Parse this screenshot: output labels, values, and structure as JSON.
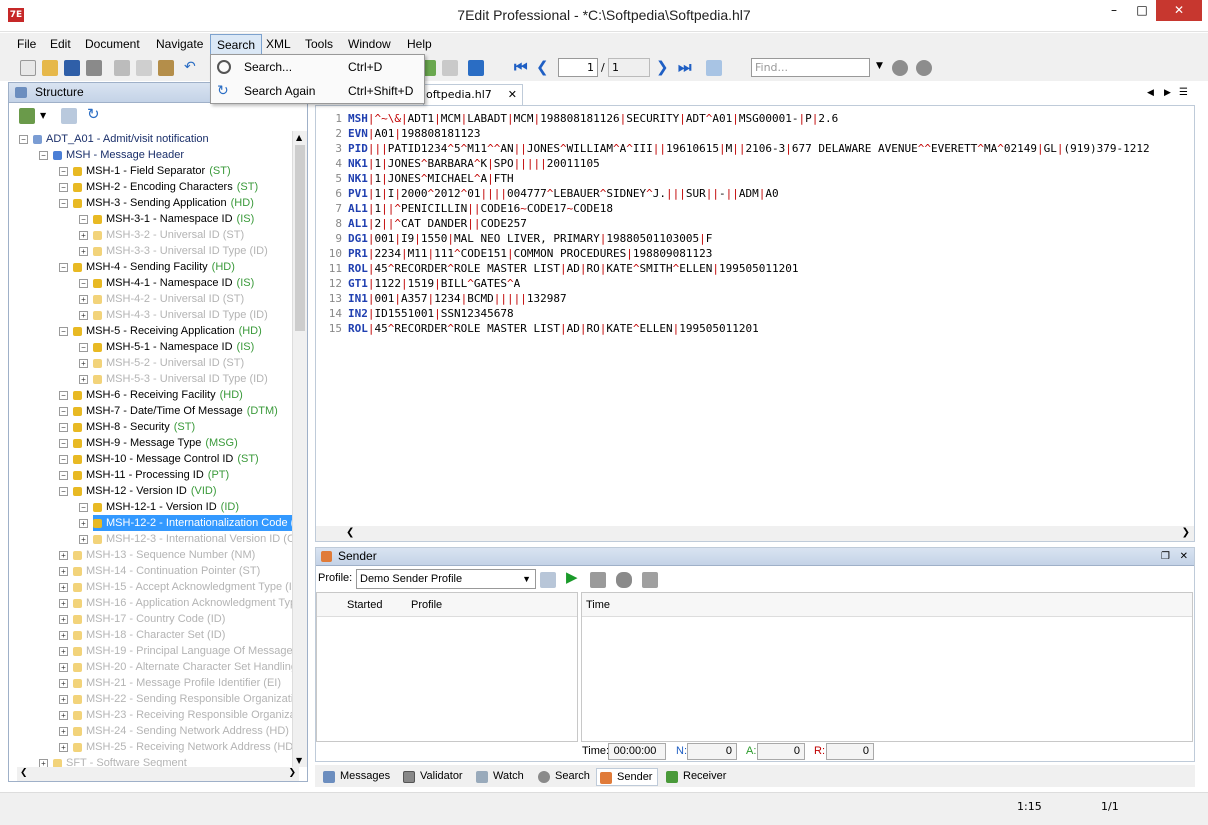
{
  "window": {
    "title": "7Edit Professional - *C:\\Softpedia\\Softpedia.hl7"
  },
  "menu": [
    "File",
    "Edit",
    "Document",
    "Navigate",
    "Search",
    "XML",
    "Tools",
    "Window",
    "Help"
  ],
  "search_menu": [
    {
      "label": "Search...",
      "shortcut": "Ctrl+D"
    },
    {
      "label": "Search Again",
      "shortcut": "Ctrl+Shift+D"
    }
  ],
  "toolbar": {
    "page_current": "1",
    "page_sep": "/",
    "page_total": "1",
    "find_placeholder": "Find..."
  },
  "structure": {
    "title": "Structure",
    "rows": [
      {
        "text": "ADT_A01 - Admit/visit notification",
        "type": "",
        "level": 0,
        "style": "root"
      },
      {
        "text": "MSH - Message Header",
        "type": "",
        "level": 1,
        "style": "seg"
      },
      {
        "text": "MSH-1 - Field Separator",
        "type": "(ST)",
        "level": 2,
        "style": "f"
      },
      {
        "text": "MSH-2 - Encoding Characters",
        "type": "(ST)",
        "level": 2,
        "style": "f"
      },
      {
        "text": "MSH-3 - Sending Application",
        "type": "(HD)",
        "level": 2,
        "style": "f"
      },
      {
        "text": "MSH-3-1 - Namespace ID",
        "type": "(IS)",
        "level": 3,
        "style": "f"
      },
      {
        "text": "MSH-3-2 - Universal ID (ST)",
        "type": "",
        "level": 3,
        "style": "lite"
      },
      {
        "text": "MSH-3-3 - Universal ID Type (ID)",
        "type": "",
        "level": 3,
        "style": "lite"
      },
      {
        "text": "MSH-4 - Sending Facility",
        "type": "(HD)",
        "level": 2,
        "style": "f"
      },
      {
        "text": "MSH-4-1 - Namespace ID",
        "type": "(IS)",
        "level": 3,
        "style": "f"
      },
      {
        "text": "MSH-4-2 - Universal ID (ST)",
        "type": "",
        "level": 3,
        "style": "lite"
      },
      {
        "text": "MSH-4-3 - Universal ID Type (ID)",
        "type": "",
        "level": 3,
        "style": "lite"
      },
      {
        "text": "MSH-5 - Receiving Application",
        "type": "(HD)",
        "level": 2,
        "style": "f"
      },
      {
        "text": "MSH-5-1 - Namespace ID",
        "type": "(IS)",
        "level": 3,
        "style": "f"
      },
      {
        "text": "MSH-5-2 - Universal ID (ST)",
        "type": "",
        "level": 3,
        "style": "lite"
      },
      {
        "text": "MSH-5-3 - Universal ID Type (ID)",
        "type": "",
        "level": 3,
        "style": "lite"
      },
      {
        "text": "MSH-6 - Receiving Facility",
        "type": "(HD)",
        "level": 2,
        "style": "f"
      },
      {
        "text": "MSH-7 - Date/Time Of Message",
        "type": "(DTM)",
        "level": 2,
        "style": "f"
      },
      {
        "text": "MSH-8 - Security",
        "type": "(ST)",
        "level": 2,
        "style": "f"
      },
      {
        "text": "MSH-9 - Message Type",
        "type": "(MSG)",
        "level": 2,
        "style": "f"
      },
      {
        "text": "MSH-10 - Message Control ID",
        "type": "(ST)",
        "level": 2,
        "style": "f"
      },
      {
        "text": "MSH-11 - Processing ID",
        "type": "(PT)",
        "level": 2,
        "style": "f"
      },
      {
        "text": "MSH-12 - Version ID",
        "type": "(VID)",
        "level": 2,
        "style": "f"
      },
      {
        "text": "MSH-12-1 - Version ID",
        "type": "(ID)",
        "level": 3,
        "style": "f"
      },
      {
        "text": "MSH-12-2 - Internationalization Code (CW",
        "type": "",
        "level": 3,
        "style": "sel"
      },
      {
        "text": "MSH-12-3 - International Version ID (CWE",
        "type": "",
        "level": 3,
        "style": "lite"
      },
      {
        "text": "MSH-13 - Sequence Number (NM)",
        "type": "",
        "level": 2,
        "style": "lite"
      },
      {
        "text": "MSH-14 - Continuation Pointer (ST)",
        "type": "",
        "level": 2,
        "style": "lite"
      },
      {
        "text": "MSH-15 - Accept Acknowledgment Type (ID)",
        "type": "",
        "level": 2,
        "style": "lite"
      },
      {
        "text": "MSH-16 - Application Acknowledgment Type (",
        "type": "",
        "level": 2,
        "style": "lite"
      },
      {
        "text": "MSH-17 - Country Code (ID)",
        "type": "",
        "level": 2,
        "style": "lite"
      },
      {
        "text": "MSH-18 - Character Set (ID)",
        "type": "",
        "level": 2,
        "style": "lite"
      },
      {
        "text": "MSH-19 - Principal Language Of Message (CW",
        "type": "",
        "level": 2,
        "style": "lite"
      },
      {
        "text": "MSH-20 - Alternate Character Set Handling S",
        "type": "",
        "level": 2,
        "style": "lite"
      },
      {
        "text": "MSH-21 - Message Profile Identifier (EI)",
        "type": "",
        "level": 2,
        "style": "lite"
      },
      {
        "text": "MSH-22 - Sending Responsible Organization (",
        "type": "",
        "level": 2,
        "style": "lite"
      },
      {
        "text": "MSH-23 - Receiving Responsible Organization",
        "type": "",
        "level": 2,
        "style": "lite"
      },
      {
        "text": "MSH-24 - Sending Network Address (HD)",
        "type": "",
        "level": 2,
        "style": "lite"
      },
      {
        "text": "MSH-25 - Receiving Network Address (HD)",
        "type": "",
        "level": 2,
        "style": "lite"
      },
      {
        "text": "SFT - Software Segment",
        "type": "",
        "level": 1,
        "style": "lite"
      }
    ]
  },
  "editor": {
    "tab": "oftpedia.hl7",
    "lines": [
      {
        "n": "1",
        "seg": "MSH",
        "rest": "|^~\\&|ADT1|MCM|LABADT|MCM|198808181126|SECURITY|ADT^A01|MSG00001-|P|2.6"
      },
      {
        "n": "2",
        "seg": "EVN",
        "rest": "|A01|198808181123"
      },
      {
        "n": "3",
        "seg": "PID",
        "rest": "|||PATID1234^5^M11^^AN||JONES^WILLIAM^A^III||19610615|M||2106-3|677 DELAWARE AVENUE^^EVERETT^MA^02149|GL|(919)379-1212"
      },
      {
        "n": "4",
        "seg": "NK1",
        "rest": "|1|JONES^BARBARA^K|SPO|||||20011105"
      },
      {
        "n": "5",
        "seg": "NK1",
        "rest": "|1|JONES^MICHAEL^A|FTH"
      },
      {
        "n": "6",
        "seg": "PV1",
        "rest": "|1|I|2000^2012^01||||004777^LEBAUER^SIDNEY^J.|||SUR||-||ADM|A0"
      },
      {
        "n": "7",
        "seg": "AL1",
        "rest": "|1||^PENICILLIN||CODE16~CODE17~CODE18"
      },
      {
        "n": "8",
        "seg": "AL1",
        "rest": "|2||^CAT DANDER||CODE257"
      },
      {
        "n": "9",
        "seg": "DG1",
        "rest": "|001|I9|1550|MAL NEO LIVER, PRIMARY|19880501103005|F"
      },
      {
        "n": "10",
        "seg": "PR1",
        "rest": "|2234|M11|111^CODE151|COMMON PROCEDURES|198809081123"
      },
      {
        "n": "11",
        "seg": "ROL",
        "rest": "|45^RECORDER^ROLE MASTER LIST|AD|RO|KATE^SMITH^ELLEN|199505011201"
      },
      {
        "n": "12",
        "seg": "GT1",
        "rest": "|1122|1519|BILL^GATES^A"
      },
      {
        "n": "13",
        "seg": "IN1",
        "rest": "|001|A357|1234|BCMD|||||132987"
      },
      {
        "n": "14",
        "seg": "IN2",
        "rest": "|ID1551001|SSN12345678"
      },
      {
        "n": "15",
        "seg": "ROL",
        "rest": "|45^RECORDER^ROLE MASTER LIST|AD|RO|KATE^ELLEN|199505011201"
      }
    ]
  },
  "sender": {
    "title": "Sender",
    "profile_label": "Profile:",
    "profile_value": "Demo Sender Profile",
    "col_started": "Started",
    "col_profile": "Profile",
    "col_time": "Time",
    "time_label": "Time:",
    "time_value": "00:00:00",
    "n_label": "N:",
    "n_value": "0",
    "a_label": "A:",
    "a_value": "0",
    "r_label": "R:",
    "r_value": "0"
  },
  "bottom_tabs": [
    "Messages",
    "Validator",
    "Watch",
    "Search",
    "Sender",
    "Receiver"
  ],
  "status": {
    "position": "1:15",
    "page": "1/1"
  },
  "colors": {
    "selection": "#3399ff",
    "segment": "#1f3fb0",
    "separator": "#c00000",
    "type": "#3a9a3a"
  }
}
